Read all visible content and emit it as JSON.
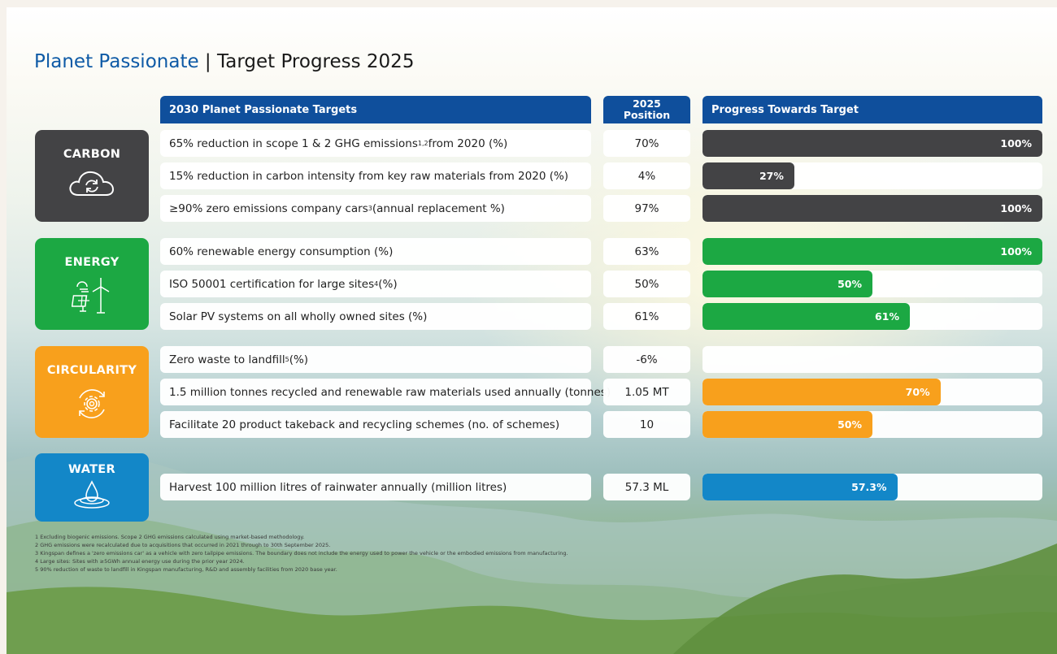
{
  "title": {
    "brand": "Planet Passionate",
    "separator": " | ",
    "rest": "Target Progress 2025"
  },
  "headers": {
    "targets": "2030 Planet Passionate Targets",
    "position_line1": "2025",
    "position_line2": "Position",
    "progress": "Progress Towards Target"
  },
  "colors": {
    "carbon": "#434345",
    "energy": "#1ca843",
    "circularity": "#f8a01c",
    "water": "#1387c8",
    "header": "#0f4f9c"
  },
  "categories": {
    "carbon": {
      "label": "CARBON",
      "icon": "cloud-refresh-icon"
    },
    "energy": {
      "label": "ENERGY",
      "icon": "solar-wind-icon"
    },
    "circularity": {
      "label": "CIRCULARITY",
      "icon": "recycle-gear-icon"
    },
    "water": {
      "label": "WATER",
      "icon": "water-drop-icon"
    }
  },
  "rows": {
    "r0": {
      "text": "65% reduction in scope 1 & 2 GHG emissions",
      "sup": "1,2",
      "after": " from 2020 (%)",
      "position": "70%",
      "progress": "100%",
      "progress_value": 100
    },
    "r1": {
      "text": "15% reduction in carbon intensity from key raw materials from 2020 (%)",
      "sup": "",
      "after": "",
      "position": "4%",
      "progress": "27%",
      "progress_value": 27
    },
    "r2": {
      "text": "≥90% zero emissions company cars",
      "sup": "3",
      "after": " (annual replacement %)",
      "position": "97%",
      "progress": "100%",
      "progress_value": 100
    },
    "r3": {
      "text": "60% renewable energy consumption (%)",
      "sup": "",
      "after": "",
      "position": "63%",
      "progress": "100%",
      "progress_value": 100
    },
    "r4": {
      "text": "ISO 50001 certification for large sites",
      "sup": "4",
      "after": " (%)",
      "position": "50%",
      "progress": "50%",
      "progress_value": 50
    },
    "r5": {
      "text": "Solar PV systems on all wholly owned sites (%)",
      "sup": "",
      "after": "",
      "position": "61%",
      "progress": "61%",
      "progress_value": 61
    },
    "r6": {
      "text": "Zero waste to landfill",
      "sup": "5",
      "after": " (%)",
      "position": "-6%",
      "progress": "",
      "progress_value": 0
    },
    "r7": {
      "text": "1.5 million tonnes recycled and renewable raw materials used annually (tonnes)",
      "sup": "",
      "after": "",
      "position": "1.05 MT",
      "progress": "70%",
      "progress_value": 70
    },
    "r8": {
      "text": "Facilitate 20 product takeback and recycling schemes (no. of schemes)",
      "sup": "",
      "after": "",
      "position": "10",
      "progress": "50%",
      "progress_value": 50
    },
    "r9": {
      "text": "Harvest 100 million litres of rainwater annually (million litres)",
      "sup": "",
      "after": "",
      "position": "57.3 ML",
      "progress": "57.3%",
      "progress_value": 57.3
    }
  },
  "footnotes": [
    "1 Excluding biogenic emissions. Scope 2 GHG emissions calculated using market-based methodology.",
    "2 GHG emissions were recalculated due to acquisitions that occurred in 2021 through to 30th September 2025.",
    "3 Kingspan defines a 'zero emissions car' as a vehicle with zero tailpipe emissions. The boundary does not include the energy used to power the vehicle or the embodied emissions from manufacturing.",
    "4 Large sites: Sites with ≥5GWh annual energy use during the prior year 2024.",
    "5 90% reduction of waste to landfill in Kingspan manufacturing, R&D and assembly facilities from 2020 base year."
  ]
}
